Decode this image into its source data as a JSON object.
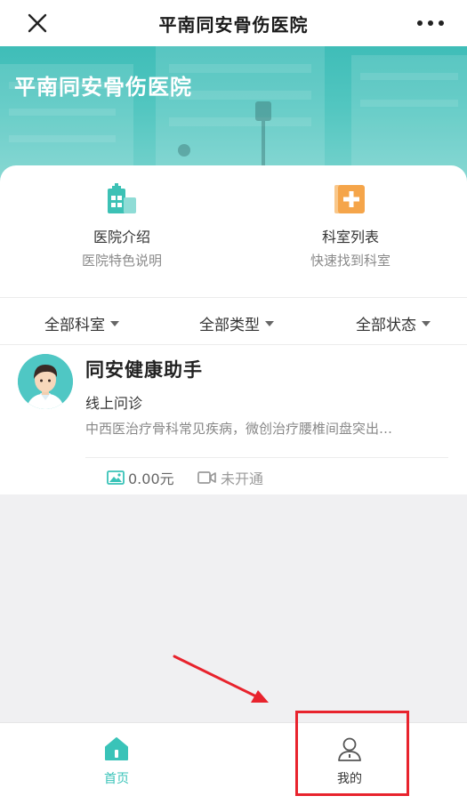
{
  "topbar": {
    "title": "平南同安骨伤医院",
    "close_icon": "close-icon",
    "more_icon": "more-icon"
  },
  "banner": {
    "hospital_name": "平南同安骨伤医院"
  },
  "features": [
    {
      "title": "医院介绍",
      "subtitle": "医院特色说明",
      "icon": "hospital-building-icon",
      "color": "#3cc1b5"
    },
    {
      "title": "科室列表",
      "subtitle": "快速找到科室",
      "icon": "plus-square-icon",
      "color": "#f5a54a"
    }
  ],
  "filters": {
    "department": "全部科室",
    "type": "全部类型",
    "status": "全部状态"
  },
  "doctor": {
    "name": "同安健康助手",
    "service": "线上问诊",
    "description": "中西医治疗骨科常见疾病，微创治疗腰椎间盘突出…",
    "image_consult_price": "0.00元",
    "video_status": "未开通"
  },
  "tabbar": {
    "home": {
      "label": "首页",
      "icon": "home-icon",
      "active": true
    },
    "mine": {
      "label": "我的",
      "icon": "user-icon",
      "active": false
    }
  },
  "colors": {
    "accent": "#39c3b8",
    "orange": "#f5a54a",
    "highlight": "#e8232d"
  }
}
